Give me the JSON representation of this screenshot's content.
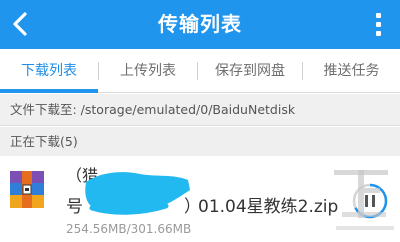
{
  "header": {
    "title": "传输列表"
  },
  "tabs": [
    {
      "label": "下载列表",
      "active": true
    },
    {
      "label": "上传列表",
      "active": false
    },
    {
      "label": "保存到网盘",
      "active": false
    },
    {
      "label": "推送任务",
      "active": false
    }
  ],
  "download_path": {
    "label": "文件下载至: /storage/emulated/0/BaiduNetdisk"
  },
  "section": {
    "label": "正在下载(5)"
  },
  "download_item": {
    "name_top": "（猎",
    "name_prefix": "号",
    "name_paren": "）",
    "name_suffix": "01.04星教练2.zip",
    "size": "254.56MB/301.66MB",
    "icon": "zip-archive-icon",
    "action_icon": "pause-icon"
  },
  "colors": {
    "accent": "#1f95ee",
    "redaction": "#22b8f0"
  }
}
